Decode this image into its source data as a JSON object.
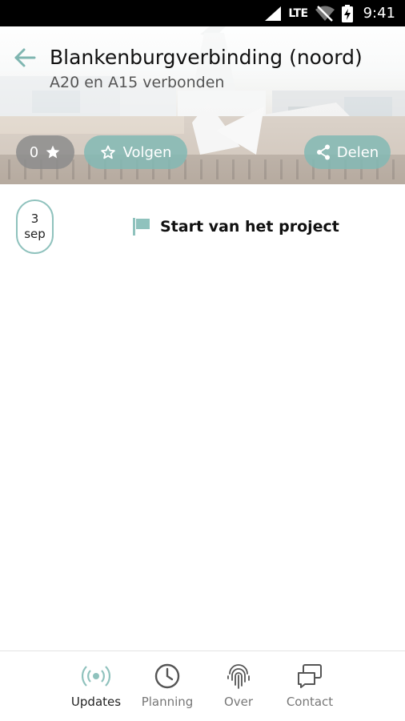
{
  "status_bar": {
    "network": "LTE",
    "time": "9:41"
  },
  "header": {
    "title": "Blankenburgverbinding (noord)",
    "subtitle": "A20 en A15 verbonden",
    "stars_count": "0",
    "follow_label": "Volgen",
    "share_label": "Delen"
  },
  "timeline": [
    {
      "day": "3",
      "month": "sep",
      "label": "Start van het project"
    }
  ],
  "nav": [
    {
      "label": "Updates",
      "icon": "radio-waves-icon",
      "active": true
    },
    {
      "label": "Planning",
      "icon": "clock-icon",
      "active": false
    },
    {
      "label": "Over",
      "icon": "fingerprint-icon",
      "active": false
    },
    {
      "label": "Contact",
      "icon": "chat-icon",
      "active": false
    }
  ],
  "colors": {
    "accent": "#8fc2bd",
    "pill_teal": "#82b9b4",
    "pill_grey": "#8c8c8c"
  }
}
